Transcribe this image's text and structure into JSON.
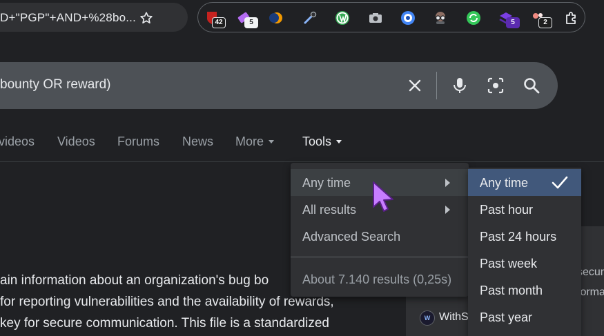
{
  "browser": {
    "url_fragment": "D+\"PGP\"+AND+%28bo...",
    "extensions": [
      {
        "icon": "red-shield-ext-icon",
        "badge": "42"
      },
      {
        "icon": "purple-eraser-ext-icon",
        "badge": "5"
      },
      {
        "icon": "orange-moon-ext-icon",
        "badge": ""
      },
      {
        "icon": "eyedropper-ext-icon",
        "badge": ""
      },
      {
        "icon": "green-wordpress-ext-icon",
        "badge": ""
      },
      {
        "icon": "camera-ext-icon",
        "badge": ""
      },
      {
        "icon": "blue-target-ext-icon",
        "badge": ""
      },
      {
        "icon": "glasses-ext-icon",
        "badge": ""
      },
      {
        "icon": "green-refresh-ext-icon",
        "badge": ""
      },
      {
        "icon": "purple-stack-ext-icon",
        "badge": "5"
      },
      {
        "icon": "pink-dots-ext-icon",
        "badge": "2"
      },
      {
        "icon": "puzzle-ext-icon",
        "badge": ""
      }
    ]
  },
  "search": {
    "query": "bounty OR reward)"
  },
  "tabs": [
    {
      "label": "videos"
    },
    {
      "label": "Videos"
    },
    {
      "label": "Forums"
    },
    {
      "label": "News"
    },
    {
      "label": "More"
    },
    {
      "label": "Tools"
    }
  ],
  "tools_menu": {
    "items": [
      {
        "label": "Any time"
      },
      {
        "label": "All results"
      },
      {
        "label": "Advanced Search"
      }
    ],
    "stats": "About 7.140 results (0,25s)"
  },
  "time_menu": {
    "options": [
      "Any time",
      "Past hour",
      "Past 24 hours",
      "Past week",
      "Past month",
      "Past year"
    ],
    "selected": "Any time"
  },
  "result": {
    "lines": [
      "ain information about an organization's bug bo",
      "for reporting vulnerabilities and the availability of rewards,",
      "key for secure communication. This file is a standardized"
    ]
  },
  "side_card": {
    "text_1": "securi",
    "text_2": "forma",
    "logo_text": "W",
    "source_name": "WithS"
  },
  "colors": {
    "background": "#202124",
    "menu": "#303134",
    "selected": "#41587b"
  }
}
